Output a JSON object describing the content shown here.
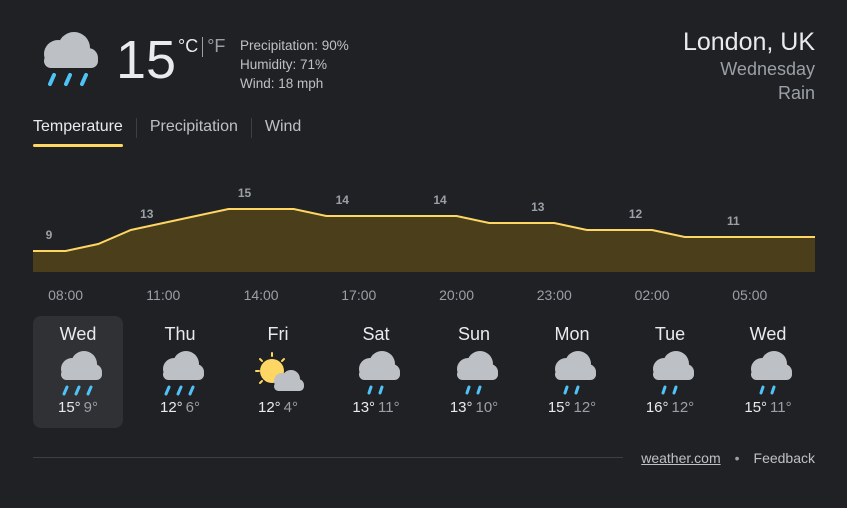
{
  "current": {
    "icon": "rain-cloud-icon",
    "temp": "15",
    "unit_c": "°C",
    "unit_f": "°F",
    "precipitation": "Precipitation: 90%",
    "humidity": "Humidity: 71%",
    "wind": "Wind: 18 mph"
  },
  "location": {
    "city": "London, UK",
    "day": "Wednesday",
    "condition": "Rain"
  },
  "tabs": [
    "Temperature",
    "Precipitation",
    "Wind"
  ],
  "active_tab": "Temperature",
  "colors": {
    "accent": "#fdd663",
    "fill": "#4a3f1a",
    "background": "#202124"
  },
  "chart_data": {
    "type": "area",
    "title": "",
    "xlabel": "",
    "ylabel": "",
    "x": [
      "07:00",
      "08:00",
      "09:00",
      "10:00",
      "11:00",
      "12:00",
      "13:00",
      "14:00",
      "15:00",
      "16:00",
      "17:00",
      "18:00",
      "19:00",
      "20:00",
      "21:00",
      "22:00",
      "23:00",
      "00:00",
      "01:00",
      "02:00",
      "03:00",
      "04:00",
      "05:00",
      "06:00",
      "07:00"
    ],
    "values": [
      9,
      9,
      10,
      12,
      13,
      14,
      15,
      15,
      15,
      14,
      14,
      14,
      14,
      14,
      13,
      13,
      13,
      12,
      12,
      12,
      11,
      11,
      11,
      11,
      11
    ],
    "point_labels": [
      {
        "index": 0,
        "label": "9"
      },
      {
        "index": 3,
        "label": "13"
      },
      {
        "index": 6,
        "label": "15"
      },
      {
        "index": 9,
        "label": "14"
      },
      {
        "index": 12,
        "label": "14"
      },
      {
        "index": 15,
        "label": "13"
      },
      {
        "index": 18,
        "label": "12"
      },
      {
        "index": 21,
        "label": "11"
      }
    ],
    "x_ticks": [
      "08:00",
      "11:00",
      "14:00",
      "17:00",
      "20:00",
      "23:00",
      "02:00",
      "05:00"
    ],
    "grid": false,
    "legend": "none"
  },
  "days": [
    {
      "name": "Wed",
      "icon": "rain-cloud-icon",
      "hi": "15°",
      "lo": "9°",
      "selected": true
    },
    {
      "name": "Thu",
      "icon": "rain-cloud-icon",
      "hi": "12°",
      "lo": "6°"
    },
    {
      "name": "Fri",
      "icon": "partly-sunny-icon",
      "hi": "12°",
      "lo": "4°"
    },
    {
      "name": "Sat",
      "icon": "showers-icon",
      "hi": "13°",
      "lo": "11°"
    },
    {
      "name": "Sun",
      "icon": "showers-icon",
      "hi": "13°",
      "lo": "10°"
    },
    {
      "name": "Mon",
      "icon": "showers-icon",
      "hi": "15°",
      "lo": "12°"
    },
    {
      "name": "Tue",
      "icon": "showers-icon",
      "hi": "16°",
      "lo": "12°"
    },
    {
      "name": "Wed",
      "icon": "showers-icon",
      "hi": "15°",
      "lo": "11°"
    }
  ],
  "footer": {
    "source": "weather.com",
    "separator": "•",
    "feedback": "Feedback"
  }
}
